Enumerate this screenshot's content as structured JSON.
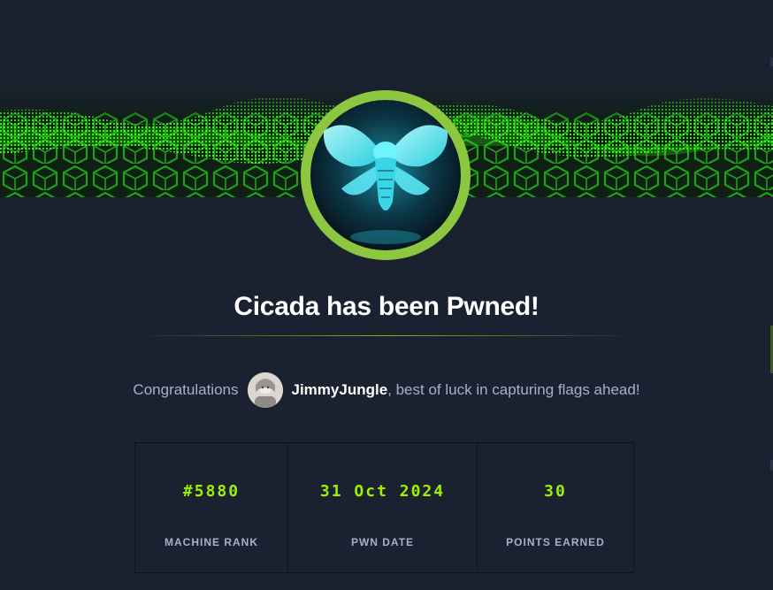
{
  "machine": {
    "name": "Cicada",
    "logo_icon": "cicada-icon",
    "colors": {
      "badge_ring": "#8dc63f",
      "badge_glow": "#3de8f0",
      "banner_green": "#39ff14"
    }
  },
  "headline": "Cicada has been Pwned!",
  "congrats": {
    "prefix": "Congratulations",
    "username": "JimmyJungle",
    "suffix": ", best of luck in capturing flags ahead!",
    "avatar_icon": "user-avatar"
  },
  "stats": [
    {
      "value": "#5880",
      "label": "MACHINE RANK"
    },
    {
      "value": "31 Oct 2024",
      "label": "PWN DATE"
    },
    {
      "value": "30",
      "label": "POINTS EARNED"
    }
  ],
  "accent_color": "#9fef00"
}
